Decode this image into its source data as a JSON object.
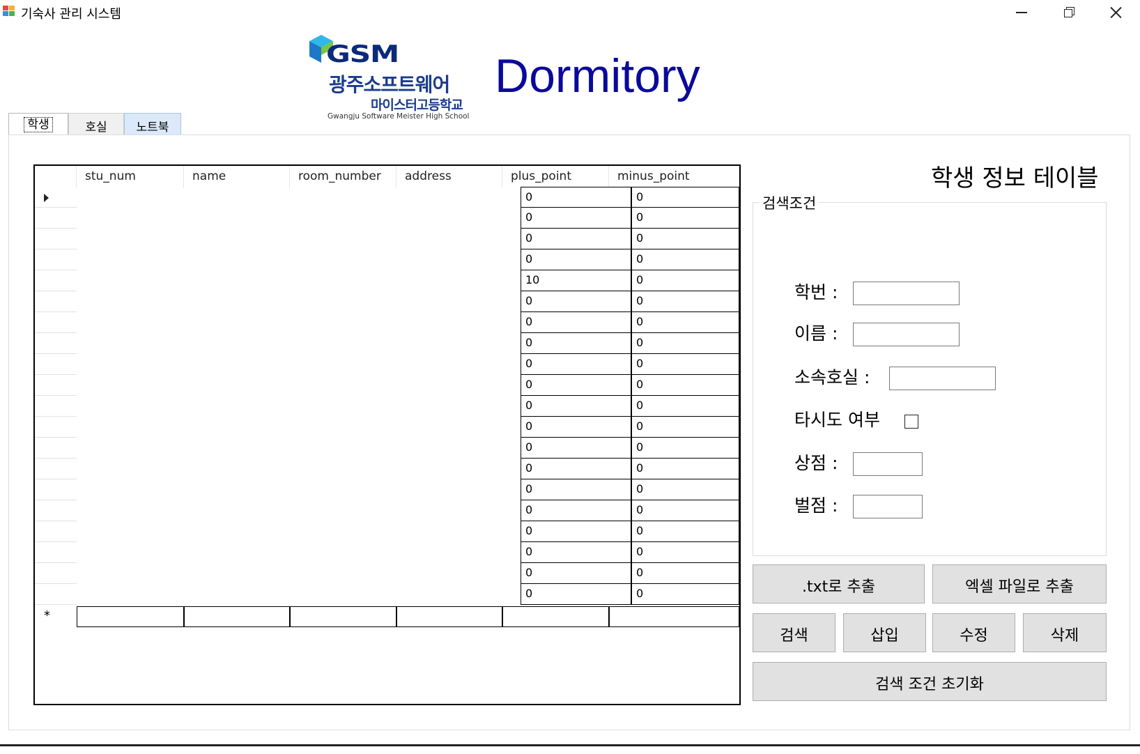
{
  "window": {
    "title": "기숙사 관리 시스템"
  },
  "logo": {
    "abbr": "GSM",
    "school_line1": "광주소프트웨어",
    "school_line2": "마이스터고등학교",
    "school_en": "Gwangju Software Meister High School"
  },
  "brand": "Dormitory",
  "tabs": [
    {
      "label": "학생",
      "selected": true
    },
    {
      "label": "호실",
      "selected": false
    },
    {
      "label": "노트북",
      "selected": false
    }
  ],
  "grid": {
    "columns": [
      "stu_num",
      "name",
      "room_number",
      "address",
      "plus_point",
      "minus_point"
    ],
    "rows": [
      {
        "plus_point": "0",
        "minus_point": "0"
      },
      {
        "plus_point": "0",
        "minus_point": "0"
      },
      {
        "plus_point": "0",
        "minus_point": "0"
      },
      {
        "plus_point": "0",
        "minus_point": "0"
      },
      {
        "plus_point": "10",
        "minus_point": "0"
      },
      {
        "plus_point": "0",
        "minus_point": "0"
      },
      {
        "plus_point": "0",
        "minus_point": "0"
      },
      {
        "plus_point": "0",
        "minus_point": "0"
      },
      {
        "plus_point": "0",
        "minus_point": "0"
      },
      {
        "plus_point": "0",
        "minus_point": "0"
      },
      {
        "plus_point": "0",
        "minus_point": "0"
      },
      {
        "plus_point": "0",
        "minus_point": "0"
      },
      {
        "plus_point": "0",
        "minus_point": "0"
      },
      {
        "plus_point": "0",
        "minus_point": "0"
      },
      {
        "plus_point": "0",
        "minus_point": "0"
      },
      {
        "plus_point": "0",
        "minus_point": "0"
      },
      {
        "plus_point": "0",
        "minus_point": "0"
      },
      {
        "plus_point": "0",
        "minus_point": "0"
      },
      {
        "plus_point": "0",
        "minus_point": "0"
      },
      {
        "plus_point": "0",
        "minus_point": "0"
      }
    ],
    "new_row_marker": "*"
  },
  "panel": {
    "title": "학생 정보 테이블",
    "group_label": "검색조건",
    "fields": {
      "stu_num_label": "학번 :",
      "name_label": "이름 :",
      "room_label": "소속호실 :",
      "other_province_label": "타시도 여부",
      "plus_label": "상점 :",
      "minus_label": "벌점 :"
    },
    "buttons": {
      "export_txt": ".txt로 추출",
      "export_excel": "엑셀 파일로 추출",
      "search": "검색",
      "insert": "삽입",
      "update": "수정",
      "delete": "삭제",
      "reset": "검색 조건 초기화"
    }
  }
}
